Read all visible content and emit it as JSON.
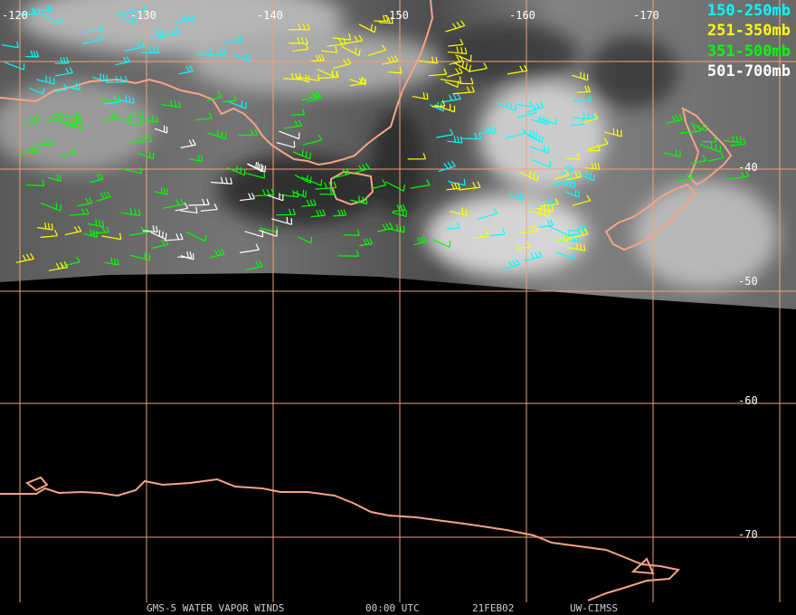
{
  "map": {
    "longitude_labels": [
      "-120",
      "-130",
      "-140",
      "-150",
      "-160",
      "-170"
    ],
    "latitude_labels": [
      "-40",
      "-50",
      "-60",
      "-70"
    ],
    "colors": {
      "gridlines": "#f0a080",
      "coastline": "#f5a585",
      "background": "#000000"
    }
  },
  "legend": [
    {
      "label": "150-250mb",
      "color": "#00ffff"
    },
    {
      "label": "251-350mb",
      "color": "#ffff00"
    },
    {
      "label": "351-500mb",
      "color": "#00ff00"
    },
    {
      "label": "501-700mb",
      "color": "#ffffff"
    }
  ],
  "footer": {
    "product": "GMS-5 WATER VAPOR WINDS",
    "time": "00:00 UTC",
    "date": "21FEB02",
    "source": "UW-CIMSS"
  }
}
